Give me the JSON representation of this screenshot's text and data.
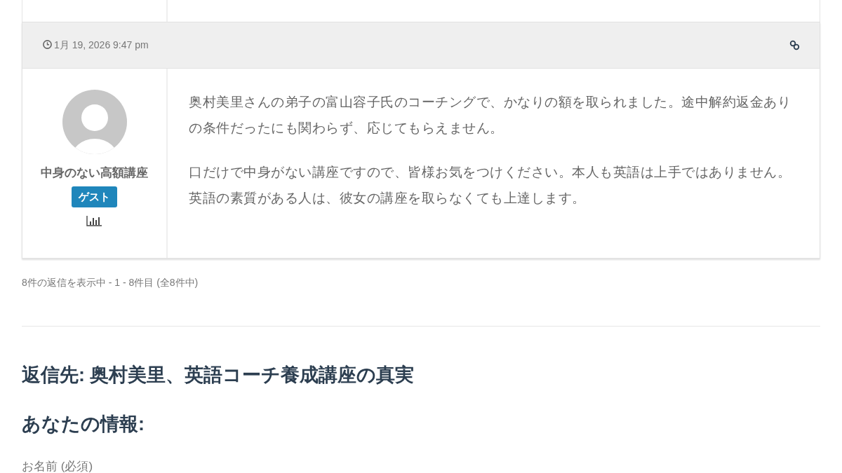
{
  "reply": {
    "timestamp": "1月 19, 2026 9:47 pm",
    "author": {
      "name": "中身のない高額講座",
      "role": "ゲスト"
    },
    "paragraphs": [
      "奥村美里さんの弟子の富山容子氏のコーチングで、かなりの額を取られました。途中解約返金ありの条件だったにも関わらず、応じてもらえません。",
      "口だけで中身がない講座ですので、皆様お気をつけください。本人も英語は上手ではありません。英語の素質がある人は、彼女の講座を取らなくても上達します。"
    ]
  },
  "pagination_info": "8件の返信を表示中 - 1 - 8件目 (全8件中)",
  "reply_form": {
    "title": "返信先: 奥村美里、英語コーチ養成講座の真実",
    "section_title": "あなたの情報:",
    "fields": [
      {
        "label": "お名前 (必須)"
      }
    ]
  }
}
